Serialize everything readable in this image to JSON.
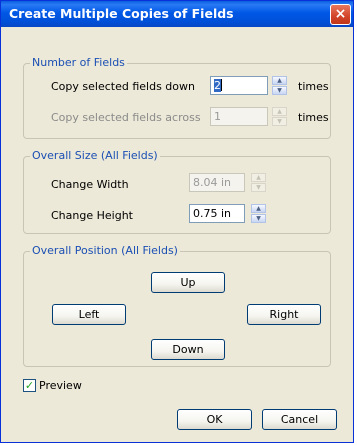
{
  "dialog": {
    "title": "Create Multiple Copies of Fields",
    "close_glyph": "×"
  },
  "number_of_fields": {
    "legend": "Number of Fields",
    "down_label": "Copy selected fields down",
    "down_value": "2",
    "down_suffix": "times",
    "across_label": "Copy selected fields across",
    "across_value": "1",
    "across_suffix": "times"
  },
  "overall_size": {
    "legend": "Overall Size (All Fields)",
    "width_label": "Change Width",
    "width_value": "8.04 in",
    "height_label": "Change Height",
    "height_value": "0.75 in"
  },
  "overall_position": {
    "legend": "Overall Position (All Fields)",
    "up_label": "Up",
    "left_label": "Left",
    "right_label": "Right",
    "down_label": "Down"
  },
  "preview": {
    "label": "Preview",
    "checked": true,
    "check_glyph": "✓"
  },
  "footer": {
    "ok_label": "OK",
    "cancel_label": "Cancel"
  },
  "icons": {
    "spin_up": "▲",
    "spin_down": "▼"
  },
  "colors": {
    "title_bar": "#0058e6",
    "group_legend": "#1b4fb4",
    "dialog_bg": "#ece9d8",
    "close_button": "#d2452a"
  }
}
